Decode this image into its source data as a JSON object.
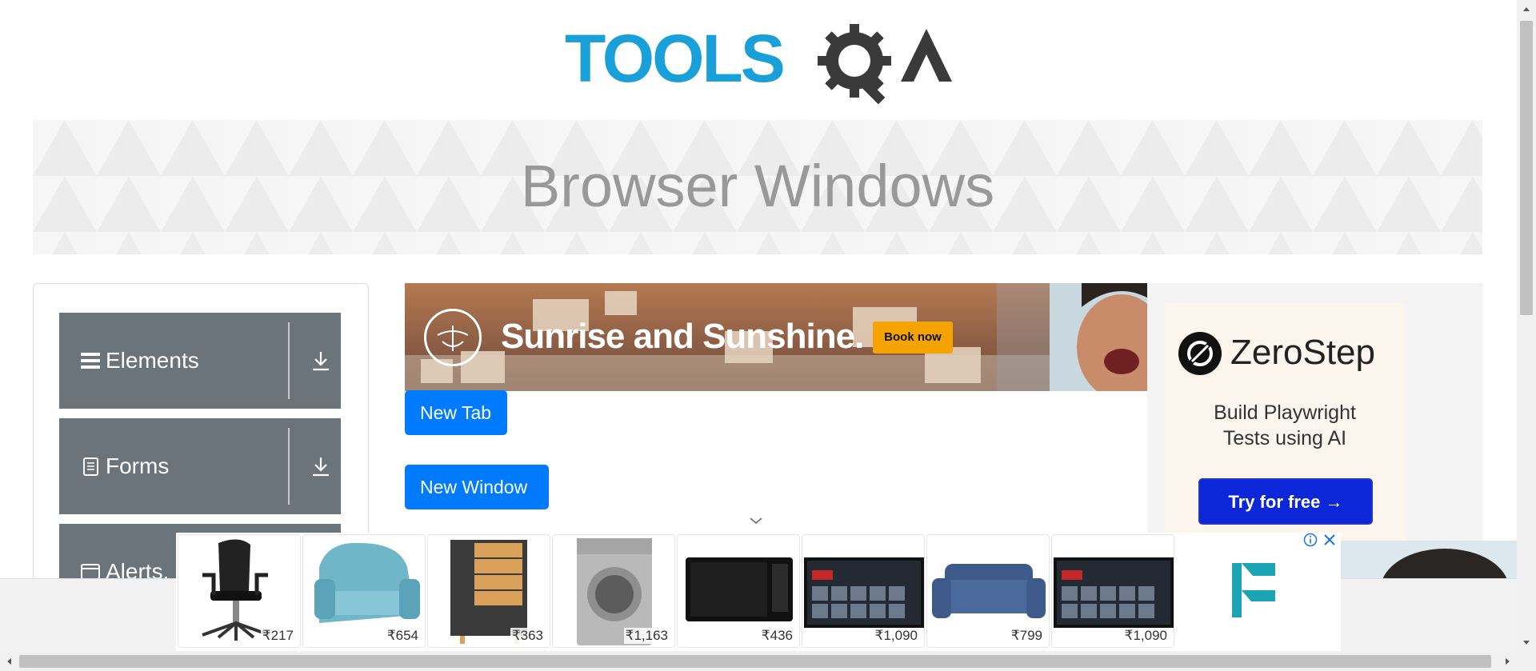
{
  "header": {
    "logo_text": "TOOLSQA"
  },
  "banner": {
    "title": "Browser Windows"
  },
  "sidebar": {
    "items": [
      {
        "label": "Elements",
        "icon": "hamburger-icon"
      },
      {
        "label": "Forms",
        "icon": "document-icon"
      },
      {
        "label": "Alerts,",
        "icon": "window-icon"
      }
    ]
  },
  "top_ad": {
    "headline": "Sunrise and Sunshine.",
    "cta": "Book now"
  },
  "buttons": {
    "new_tab": "New Tab",
    "new_window": "New Window"
  },
  "right_ad": {
    "brand": "ZeroStep",
    "tagline_line1": "Build Playwright",
    "tagline_line2": "Tests using AI",
    "cta": "Try for free →"
  },
  "bottom_ad": {
    "products": [
      {
        "name": "office-chair",
        "price": "₹217"
      },
      {
        "name": "recliner",
        "price": "₹654"
      },
      {
        "name": "drawer-cabinet",
        "price": "₹363"
      },
      {
        "name": "washing-machine",
        "price": "₹1,163"
      },
      {
        "name": "microwave",
        "price": "₹436"
      },
      {
        "name": "smart-tv",
        "price": "₹1,090"
      },
      {
        "name": "sofa",
        "price": "₹799"
      },
      {
        "name": "smart-tv-2",
        "price": "₹1,090"
      }
    ]
  },
  "colors": {
    "primary_button": "#007bff",
    "sidebar_item": "#6b737b",
    "logo_blue": "#1aa0d8",
    "logo_dark": "#3a3a3a",
    "zerostep_cta": "#0b27d8",
    "ad_cta": "#f5a300"
  }
}
